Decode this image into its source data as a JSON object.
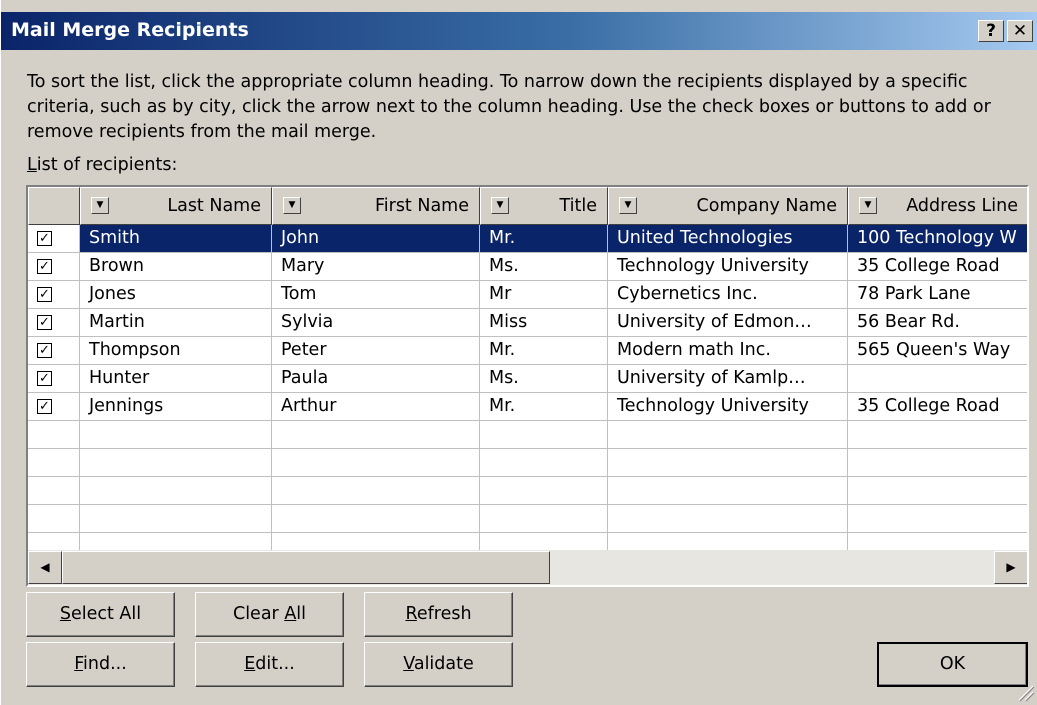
{
  "dialog": {
    "title": "Mail Merge Recipients",
    "help_glyph": "?",
    "close_glyph": "✕",
    "instructions": "To sort the list, click the appropriate column heading.  To narrow down the recipients displayed by a specific criteria, such as by city, click the arrow next to the column heading.  Use the check boxes or buttons to add or remove recipients from the mail merge.",
    "list_label_access": "L",
    "list_label_rest": "ist of recipients:"
  },
  "columns": [
    {
      "label": "Last Name"
    },
    {
      "label": "First Name"
    },
    {
      "label": "Title"
    },
    {
      "label": "Company Name"
    },
    {
      "label": "Address Line"
    }
  ],
  "rows": [
    {
      "checked": true,
      "selected": true,
      "last": "Smith",
      "first": "John",
      "title": "Mr.",
      "company": "United Technologies",
      "address": "100 Technology W"
    },
    {
      "checked": true,
      "selected": false,
      "last": "Brown",
      "first": "Mary",
      "title": "Ms.",
      "company": "Technology University",
      "address": "35 College Road"
    },
    {
      "checked": true,
      "selected": false,
      "last": "Jones",
      "first": "Tom",
      "title": "Mr",
      "company": "Cybernetics Inc.",
      "address": "78 Park Lane"
    },
    {
      "checked": true,
      "selected": false,
      "last": "Martin",
      "first": "Sylvia",
      "title": "Miss",
      "company": "University of Edmon…",
      "address": "56 Bear Rd."
    },
    {
      "checked": true,
      "selected": false,
      "last": "Thompson",
      "first": "Peter",
      "title": "Mr.",
      "company": "Modern math Inc.",
      "address": "565 Queen's Way"
    },
    {
      "checked": true,
      "selected": false,
      "last": "Hunter",
      "first": "Paula",
      "title": "Ms.",
      "company": "University of Kamlp…",
      "address": ""
    },
    {
      "checked": true,
      "selected": false,
      "last": "Jennings",
      "first": "Arthur",
      "title": "Mr.",
      "company": "Technology University",
      "address": "35 College Road"
    }
  ],
  "empty_rows": 5,
  "icons": {
    "dropdown": "▼",
    "check": "✓",
    "scroll_left": "◀",
    "scroll_right": "▶"
  },
  "buttons": {
    "select_all": {
      "access": "S",
      "rest": "elect All"
    },
    "clear_all": {
      "pre": "Clear ",
      "access": "A",
      "rest": "ll"
    },
    "refresh": {
      "access": "R",
      "rest": "efresh"
    },
    "find": {
      "access": "F",
      "rest": "ind..."
    },
    "edit": {
      "access": "E",
      "rest": "dit..."
    },
    "validate": {
      "access": "V",
      "rest": "alidate"
    },
    "ok": "OK"
  },
  "colors": {
    "selection": "#0a246a",
    "face": "#d4d0c8"
  }
}
